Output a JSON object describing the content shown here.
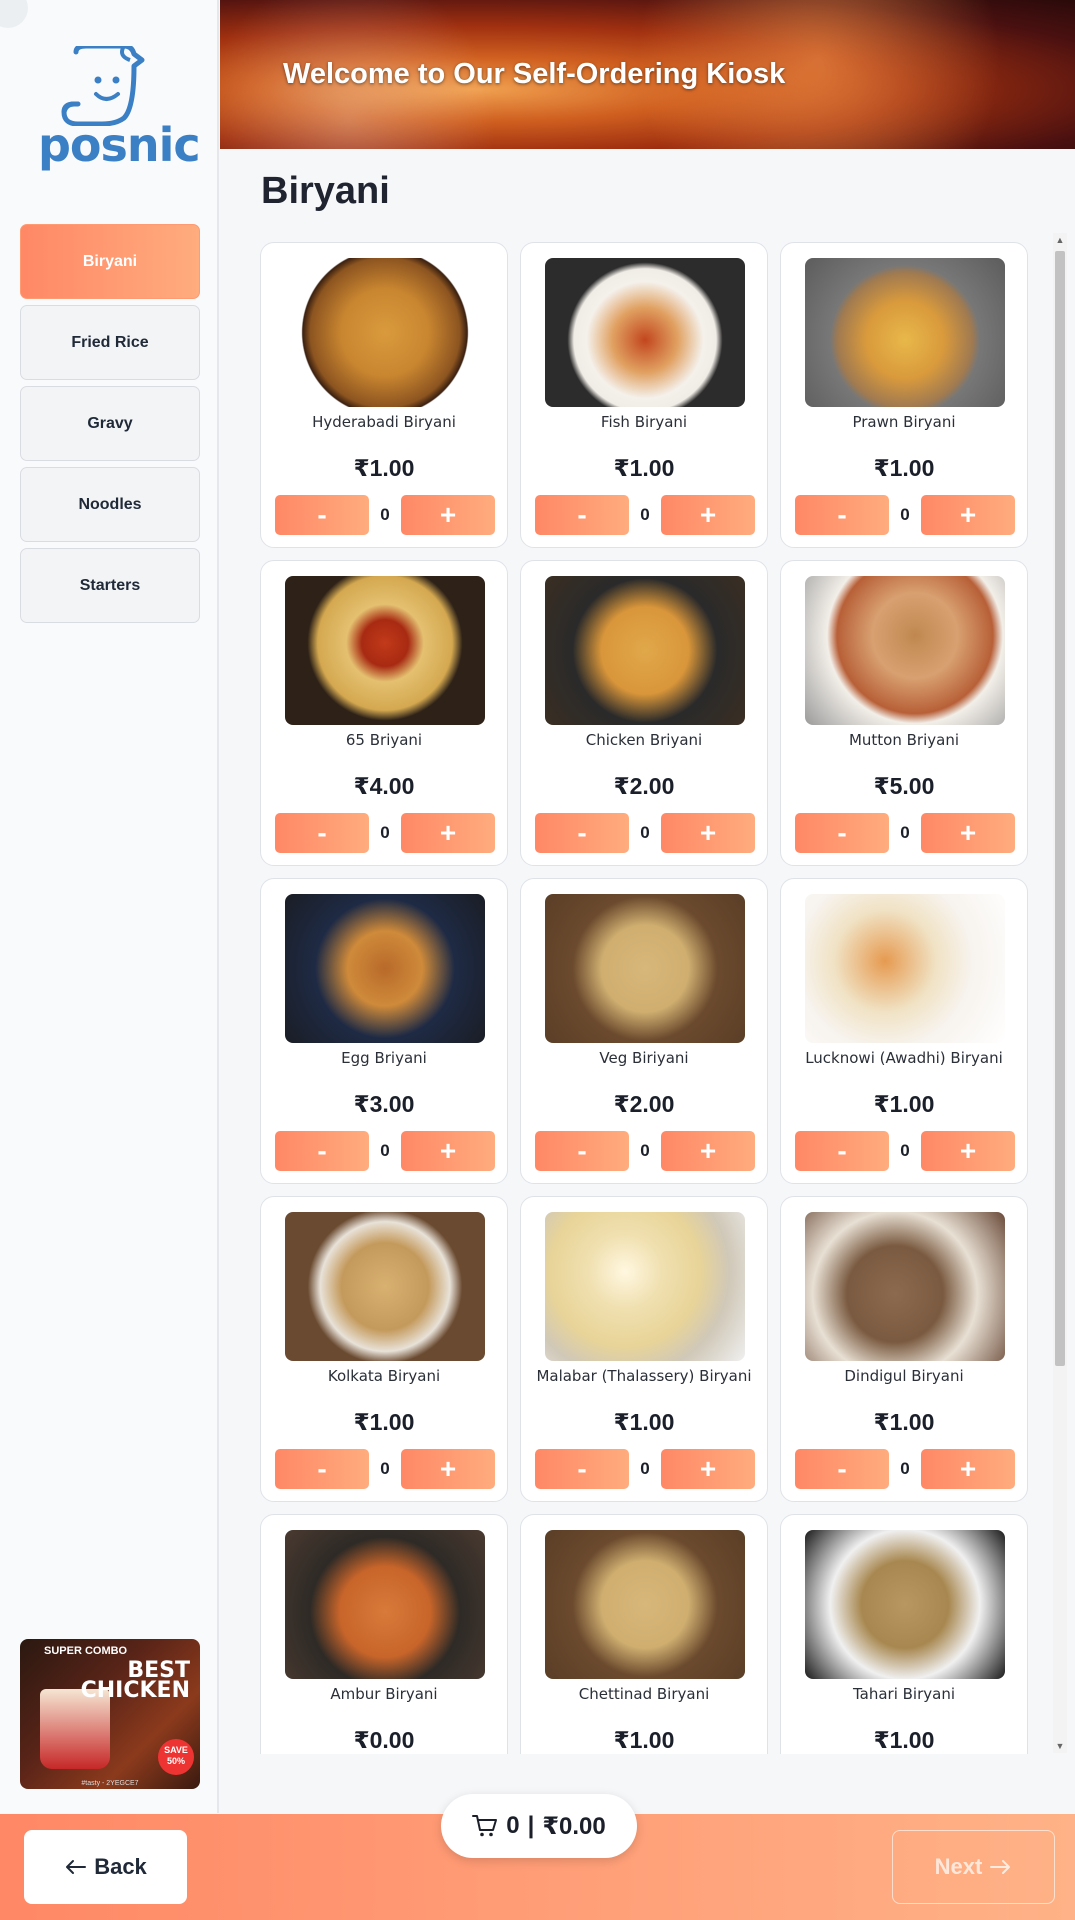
{
  "header": {
    "title": "Welcome to Our Self-Ordering Kiosk"
  },
  "brand": {
    "logo_text": "posnic",
    "logo_color": "#3b7fc4"
  },
  "sidebar": {
    "categories": [
      {
        "label": "Biryani",
        "active": true
      },
      {
        "label": "Fried Rice",
        "active": false
      },
      {
        "label": "Gravy",
        "active": false
      },
      {
        "label": "Noodles",
        "active": false
      },
      {
        "label": "Starters",
        "active": false
      }
    ],
    "promo": {
      "line1": "SUPER COMBO",
      "line2": "BEST CHICKEN",
      "badge": "SAVE 50%",
      "footer": "#tasty - 2YEGCE7"
    }
  },
  "main": {
    "section_title": "Biryani",
    "items": [
      {
        "name": "Hyderabadi Biryani",
        "price": "₹1.00",
        "qty": "0",
        "image": "f-round"
      },
      {
        "name": "Fish Biryani",
        "price": "₹1.00",
        "qty": "0",
        "image": "f-fish"
      },
      {
        "name": "Prawn Biryani",
        "price": "₹1.00",
        "qty": "0",
        "image": "f-prawn"
      },
      {
        "name": "65 Briyani",
        "price": "₹4.00",
        "qty": "0",
        "image": "f-65"
      },
      {
        "name": "Chicken Briyani",
        "price": "₹2.00",
        "qty": "0",
        "image": "f-chicken"
      },
      {
        "name": "Mutton Briyani",
        "price": "₹5.00",
        "qty": "0",
        "image": "f-mutton"
      },
      {
        "name": "Egg Briyani",
        "price": "₹3.00",
        "qty": "0",
        "image": "f-egg"
      },
      {
        "name": "Veg Biriyani",
        "price": "₹2.00",
        "qty": "0",
        "image": "f-veg"
      },
      {
        "name": "Lucknowi (Awadhi) Biryani",
        "price": "₹1.00",
        "qty": "0",
        "image": "f-luck"
      },
      {
        "name": "Kolkata Biryani",
        "price": "₹1.00",
        "qty": "0",
        "image": "f-kol"
      },
      {
        "name": "Malabar (Thalassery) Biryani",
        "price": "₹1.00",
        "qty": "0",
        "image": "f-mal"
      },
      {
        "name": "Dindigul Biryani",
        "price": "₹1.00",
        "qty": "0",
        "image": "f-din"
      },
      {
        "name": "Ambur Biryani",
        "price": "₹0.00",
        "qty": "0",
        "image": "f-amb"
      },
      {
        "name": "Chettinad Biryani",
        "price": "₹1.00",
        "qty": "0",
        "image": "f-chet"
      },
      {
        "name": "Tahari Biryani",
        "price": "₹1.00",
        "qty": "0",
        "image": "f-tah"
      }
    ],
    "minus_label": "-",
    "plus_label": "+"
  },
  "cart": {
    "count": "0",
    "separator": "|",
    "total": "₹0.00",
    "icon": "cart-icon"
  },
  "footer": {
    "back_label": "Back",
    "next_label": "Next"
  },
  "colors": {
    "accent_start": "#ff8866",
    "accent_end": "#ffac7e"
  }
}
